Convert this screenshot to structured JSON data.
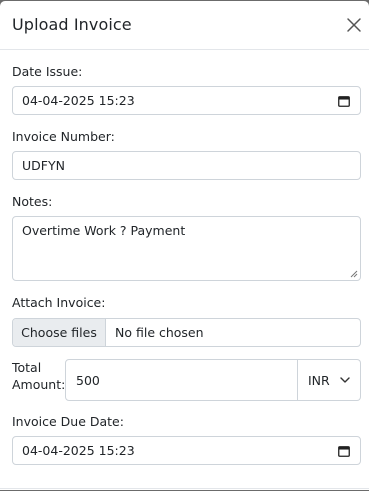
{
  "modal": {
    "title": "Upload Invoice"
  },
  "form": {
    "date_issue_label": "Date Issue:",
    "date_issue_value": "04-04-2025 15:23",
    "invoice_number_label": "Invoice Number:",
    "invoice_number_value": "UDFYN",
    "notes_label": "Notes:",
    "notes_value": "Overtime Work ? Payment",
    "attach_label": "Attach Invoice:",
    "choose_files_label": "Choose files",
    "file_status": "No file chosen",
    "total_amount_label": "Total Amount:",
    "total_amount_value": "500",
    "currency_value": "INR",
    "due_date_label": "Invoice Due Date:",
    "due_date_value": "04-04-2025 15:23"
  },
  "icons": {
    "close": "close-icon",
    "calendar": "calendar-icon",
    "chevron": "chevron-down-icon"
  }
}
